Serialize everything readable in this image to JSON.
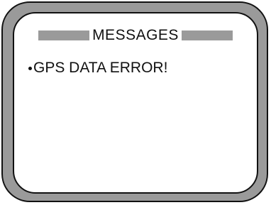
{
  "screen": {
    "title": "MESSAGES",
    "messages": [
      {
        "text": "GPS DATA ERROR!"
      }
    ]
  },
  "colors": {
    "bezel": "#9a9a9a",
    "outline": "#111111",
    "screen_background": "#ffffff",
    "title_bar": "#9a9a9a",
    "text": "#111111"
  },
  "icons": {
    "bullet": "bullet-dot-icon"
  }
}
